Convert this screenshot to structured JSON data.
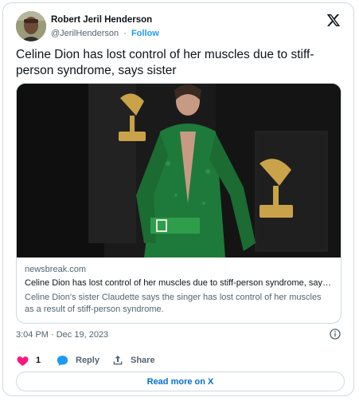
{
  "author": {
    "name": "Robert Jeril Henderson",
    "handle": "@JerilHenderson",
    "separator": "·",
    "follow_label": "Follow"
  },
  "tweet": {
    "text": "Celine Dion has lost control of her muscles due to stiff-person syndrome, says sister"
  },
  "link_card": {
    "domain": "newsbreak.com",
    "title": "Celine Dion has lost control of her muscles due to stiff-person syndrome, says...",
    "description": "Celine Dion's sister Claudette says the singer has lost control of her muscles as a result of stiff-person syndrome."
  },
  "meta": {
    "timestamp": "3:04 PM · Dec 19, 2023"
  },
  "actions": {
    "like_count": "1",
    "reply_label": "Reply",
    "share_label": "Share"
  },
  "read_more_label": "Read more on X",
  "colors": {
    "accent": "#1d9bf0",
    "link": "#006fd6",
    "like": "#f91880",
    "reply": "#1d9bf0",
    "text": "#0f1419",
    "muted": "#536471",
    "border": "#cfd9de"
  },
  "icons": [
    "x-logo-icon",
    "info-icon",
    "heart-icon",
    "reply-bubble-icon",
    "share-icon"
  ]
}
